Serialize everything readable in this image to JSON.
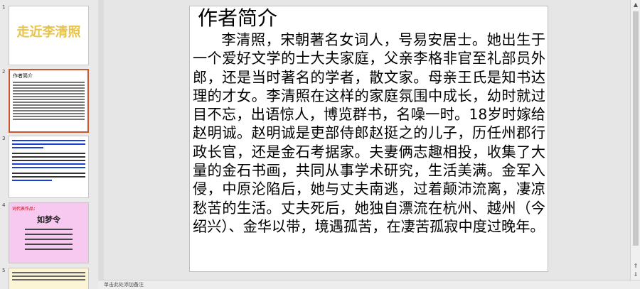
{
  "thumbnails": [
    {
      "number": "1",
      "title": "走近李清照"
    },
    {
      "number": "2",
      "title": "作者简介",
      "selected": true
    },
    {
      "number": "3"
    },
    {
      "number": "4",
      "header": "词代表作品：",
      "big": "如梦令"
    },
    {
      "number": "5"
    }
  ],
  "slide": {
    "title": "作者简介",
    "body": "李清照，宋朝著名女词人，号易安居士。她出生于一个爱好文学的士大夫家庭，父亲李格非官至礼部员外郎，还是当时著名的学者，散文家。母亲王氏是知书达理的才女。李清照在这样的家庭氛围中成长，幼时就过目不忘，出语惊人，博览群书，名噪一时。18岁时嫁给赵明诚。赵明诚是吏部侍郎赵挺之的儿子，历任州郡行政长官，还是金石考据家。夫妻俩志趣相投，收集了大量的金石书画，共同从事学术研究，生活美满。金军入侵，中原沦陷后，她与丈夫南逃，过着颠沛流离，凄凉愁苦的生活。丈夫死后，她独自漂流在杭州、越州（今绍兴）、金华以带，境遇孤苦，在凄苦孤寂中度过晚年。"
  },
  "notes": {
    "placeholder": "单击此处添加备注"
  },
  "colors": {
    "selected_border": "#c8582c",
    "title_gold": "#e8c44a",
    "thumb4_bg": "#f7c8f0",
    "thumb5_bg": "#fbf5d6"
  }
}
